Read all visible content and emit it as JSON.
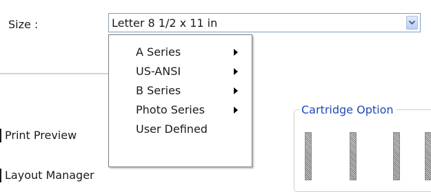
{
  "size_field": {
    "label": "Size :",
    "selected_value": "Letter 8 1/2 x 11 in"
  },
  "size_menu": {
    "items": [
      {
        "label": "A Series",
        "has_submenu": true
      },
      {
        "label": "US-ANSI",
        "has_submenu": true
      },
      {
        "label": "B Series",
        "has_submenu": true
      },
      {
        "label": "Photo Series",
        "has_submenu": true
      },
      {
        "label": "User Defined",
        "has_submenu": false
      }
    ]
  },
  "nav": {
    "print_preview": "Print Preview",
    "layout_manager": "Layout Manager"
  },
  "cartridge": {
    "title": "Cartridge Option"
  },
  "colors": {
    "group_title": "#1f49b8",
    "combo_border": "#7f9db9"
  }
}
